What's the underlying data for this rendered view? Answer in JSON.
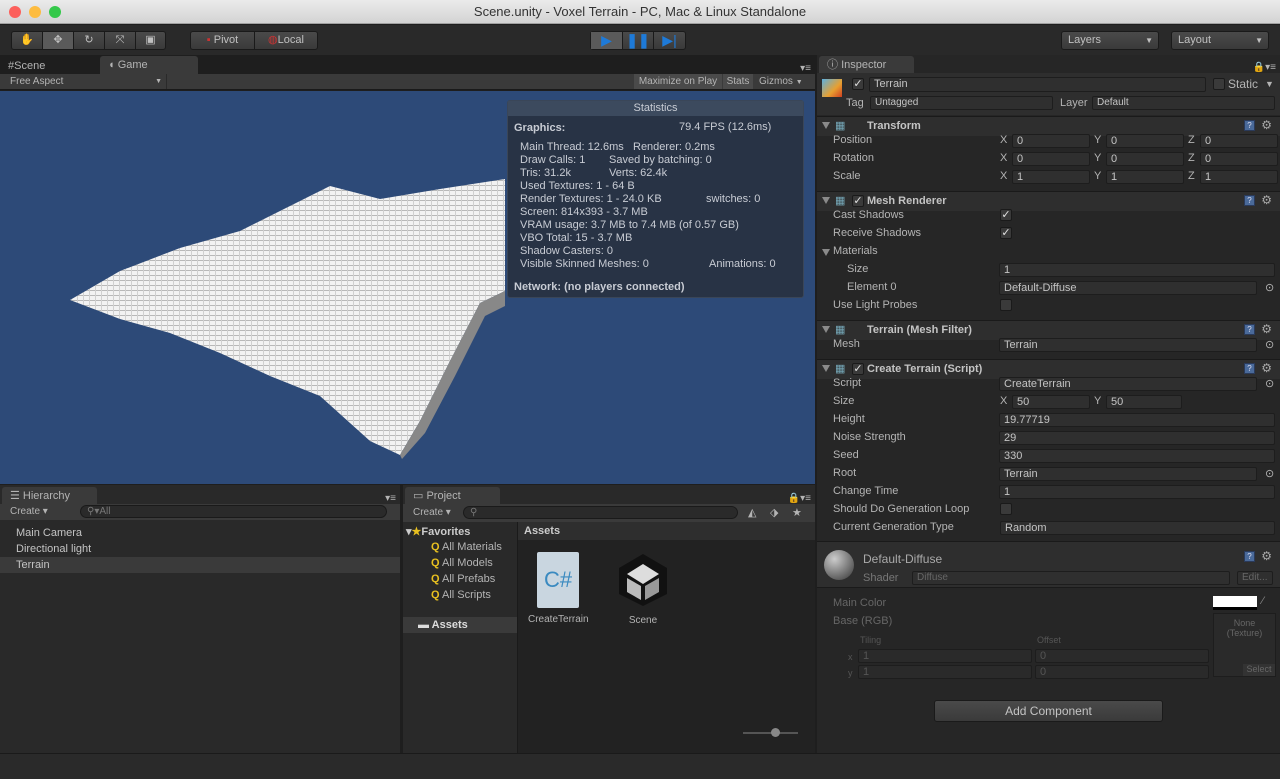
{
  "window": {
    "title": "Scene.unity - Voxel Terrain - PC, Mac & Linux Standalone"
  },
  "toolbar": {
    "tools": [
      "hand-icon",
      "move-icon",
      "rotate-icon",
      "scale-icon",
      "rect-icon"
    ],
    "pivot": "Pivot",
    "local": "Local",
    "layers": "Layers",
    "layout": "Layout",
    "play_color": "#1e7ad8"
  },
  "view": {
    "tabs": [
      {
        "label": "Scene"
      },
      {
        "label": "Game"
      }
    ],
    "aspect": "Free Aspect",
    "maximize": "Maximize on Play",
    "stats": "Stats",
    "gizmos": "Gizmos",
    "bg_color": "#2d4a78"
  },
  "statistics": {
    "title": "Statistics",
    "graphics": "Graphics:",
    "fps": "79.4 FPS (12.6ms)",
    "lines": [
      [
        "Main Thread: 12.6ms",
        "Renderer: 0.2ms"
      ],
      [
        "Draw Calls: 1",
        "Saved by batching: 0"
      ],
      [
        "Tris: 31.2k",
        "Verts: 62.4k"
      ],
      [
        "Used Textures: 1 - 64 B",
        ""
      ],
      [
        "Render Textures: 1 - 24.0 KB",
        "switches: 0"
      ],
      [
        "Screen: 814x393 - 3.7 MB",
        ""
      ],
      [
        "VRAM usage: 3.7 MB to 7.4 MB (of 0.57 GB)",
        ""
      ],
      [
        "VBO Total: 15 - 3.7 MB",
        ""
      ],
      [
        "Shadow Casters: 0",
        ""
      ],
      [
        "Visible Skinned Meshes: 0",
        "Animations: 0"
      ]
    ],
    "network": "Network: (no players connected)"
  },
  "hierarchy": {
    "tab": "Hierarchy",
    "create": "Create",
    "search": "All",
    "items": [
      {
        "label": "Main Camera"
      },
      {
        "label": "Directional light"
      },
      {
        "label": "Terrain",
        "selected": true
      }
    ]
  },
  "project": {
    "tab": "Project",
    "create": "Create",
    "favorites": "Favorites",
    "fav_items": [
      "All Materials",
      "All Models",
      "All Prefabs",
      "All Scripts"
    ],
    "assets_folder": "Assets",
    "assets_header": "Assets",
    "assets": [
      {
        "label": "CreateTerrain",
        "icon": "csharp-script-icon"
      },
      {
        "label": "Scene",
        "icon": "unity-scene-icon"
      }
    ]
  },
  "inspector": {
    "tab": "Inspector",
    "name": "Terrain",
    "active": true,
    "static": "Static",
    "tag_label": "Tag",
    "tag": "Untagged",
    "layer_label": "Layer",
    "layer": "Default",
    "transform": {
      "title": "Transform",
      "rows": [
        {
          "label": "Position",
          "x": "0",
          "y": "0",
          "z": "0"
        },
        {
          "label": "Rotation",
          "x": "0",
          "y": "0",
          "z": "0"
        },
        {
          "label": "Scale",
          "x": "1",
          "y": "1",
          "z": "1"
        }
      ]
    },
    "mesh_renderer": {
      "title": "Mesh Renderer",
      "cast": "Cast Shadows",
      "receive": "Receive Shadows",
      "materials": "Materials",
      "size_label": "Size",
      "size": "1",
      "element_label": "Element 0",
      "element": "Default-Diffuse",
      "probes": "Use Light Probes"
    },
    "mesh_filter": {
      "title": "Terrain (Mesh Filter)",
      "mesh_label": "Mesh",
      "mesh": "Terrain"
    },
    "script": {
      "title": "Create Terrain (Script)",
      "script_label": "Script",
      "script": "CreateTerrain",
      "size_label": "Size",
      "size_x": "50",
      "size_y": "50",
      "height_label": "Height",
      "height": "19.77719",
      "noise_label": "Noise Strength",
      "noise": "29",
      "seed_label": "Seed",
      "seed": "330",
      "root_label": "Root",
      "root": "Terrain",
      "change_label": "Change Time",
      "change": "1",
      "loop_label": "Should Do Generation Loop",
      "gen_label": "Current Generation Type",
      "gen": "Random"
    },
    "material": {
      "name": "Default-Diffuse",
      "shader_label": "Shader",
      "shader": "Diffuse",
      "edit": "Edit...",
      "main_color": "Main Color",
      "base": "Base (RGB)",
      "none": "None",
      "texture": "(Texture)",
      "tiling": "Tiling",
      "offset": "Offset",
      "tx": "1",
      "ty": "1",
      "ox": "0",
      "oy": "0",
      "select": "Select"
    },
    "add_component": "Add Component"
  }
}
